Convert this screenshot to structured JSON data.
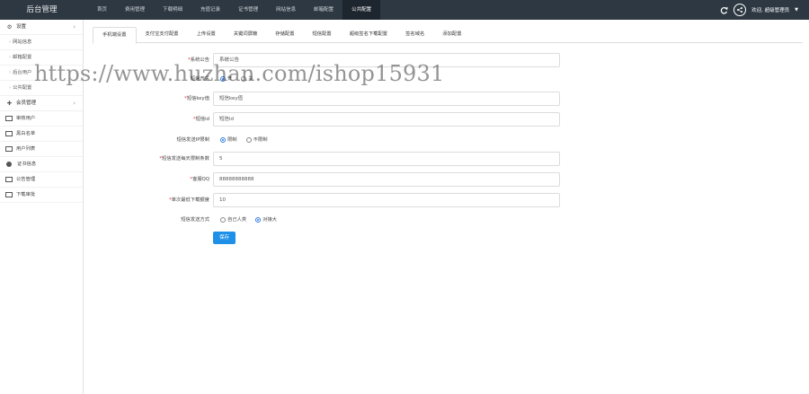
{
  "brand": "后台管理",
  "topnav": [
    "首页",
    "费用管理",
    "下载明细",
    "充值记录",
    "证书管理",
    "网站信息",
    "邮箱配置",
    "公共配置"
  ],
  "user": {
    "name": "欢迎, 超级管理员"
  },
  "sidebar": {
    "settings_group": "设置",
    "settings_items": [
      "网站信息",
      "邮箱配置",
      "后台用户",
      "公共配置"
    ],
    "member_group": "会员管理",
    "items": [
      "审核用户",
      "黑白名单",
      "用户列表",
      "证书信息",
      "公告管理",
      "下载审批"
    ]
  },
  "tabs": [
    "手机端设置",
    "支付宝支付配置",
    "上传设置",
    "关键词屏蔽",
    "存储配置",
    "短信配置",
    "超级签名下载配置",
    "签名域名",
    "添加配置"
  ],
  "form": {
    "notice": {
      "label": "系统公告",
      "value": "系统公告"
    },
    "sms_switch": {
      "label": "短信开关",
      "options": [
        "开",
        "关"
      ]
    },
    "key_id": {
      "label": "短信key值",
      "value": "短信key值"
    },
    "sms_id": {
      "label": "短信id",
      "value": "短信id"
    },
    "ip_limit": {
      "label": "短信发送IP限制",
      "options": [
        "限制",
        "不限制"
      ]
    },
    "ip_count": {
      "label": "短信发送每天限制条数",
      "value": "5"
    },
    "qq": {
      "label": "客服QQ",
      "value": "88888888888"
    },
    "min_credit": {
      "label": "单次最低下载额度",
      "value": "10"
    },
    "send_mode": {
      "label": "短信发送方式",
      "options": [
        "自己人类",
        "对接大"
      ]
    },
    "save_label": "保存"
  },
  "watermark": "https://www.huzhan.com/ishop15931"
}
